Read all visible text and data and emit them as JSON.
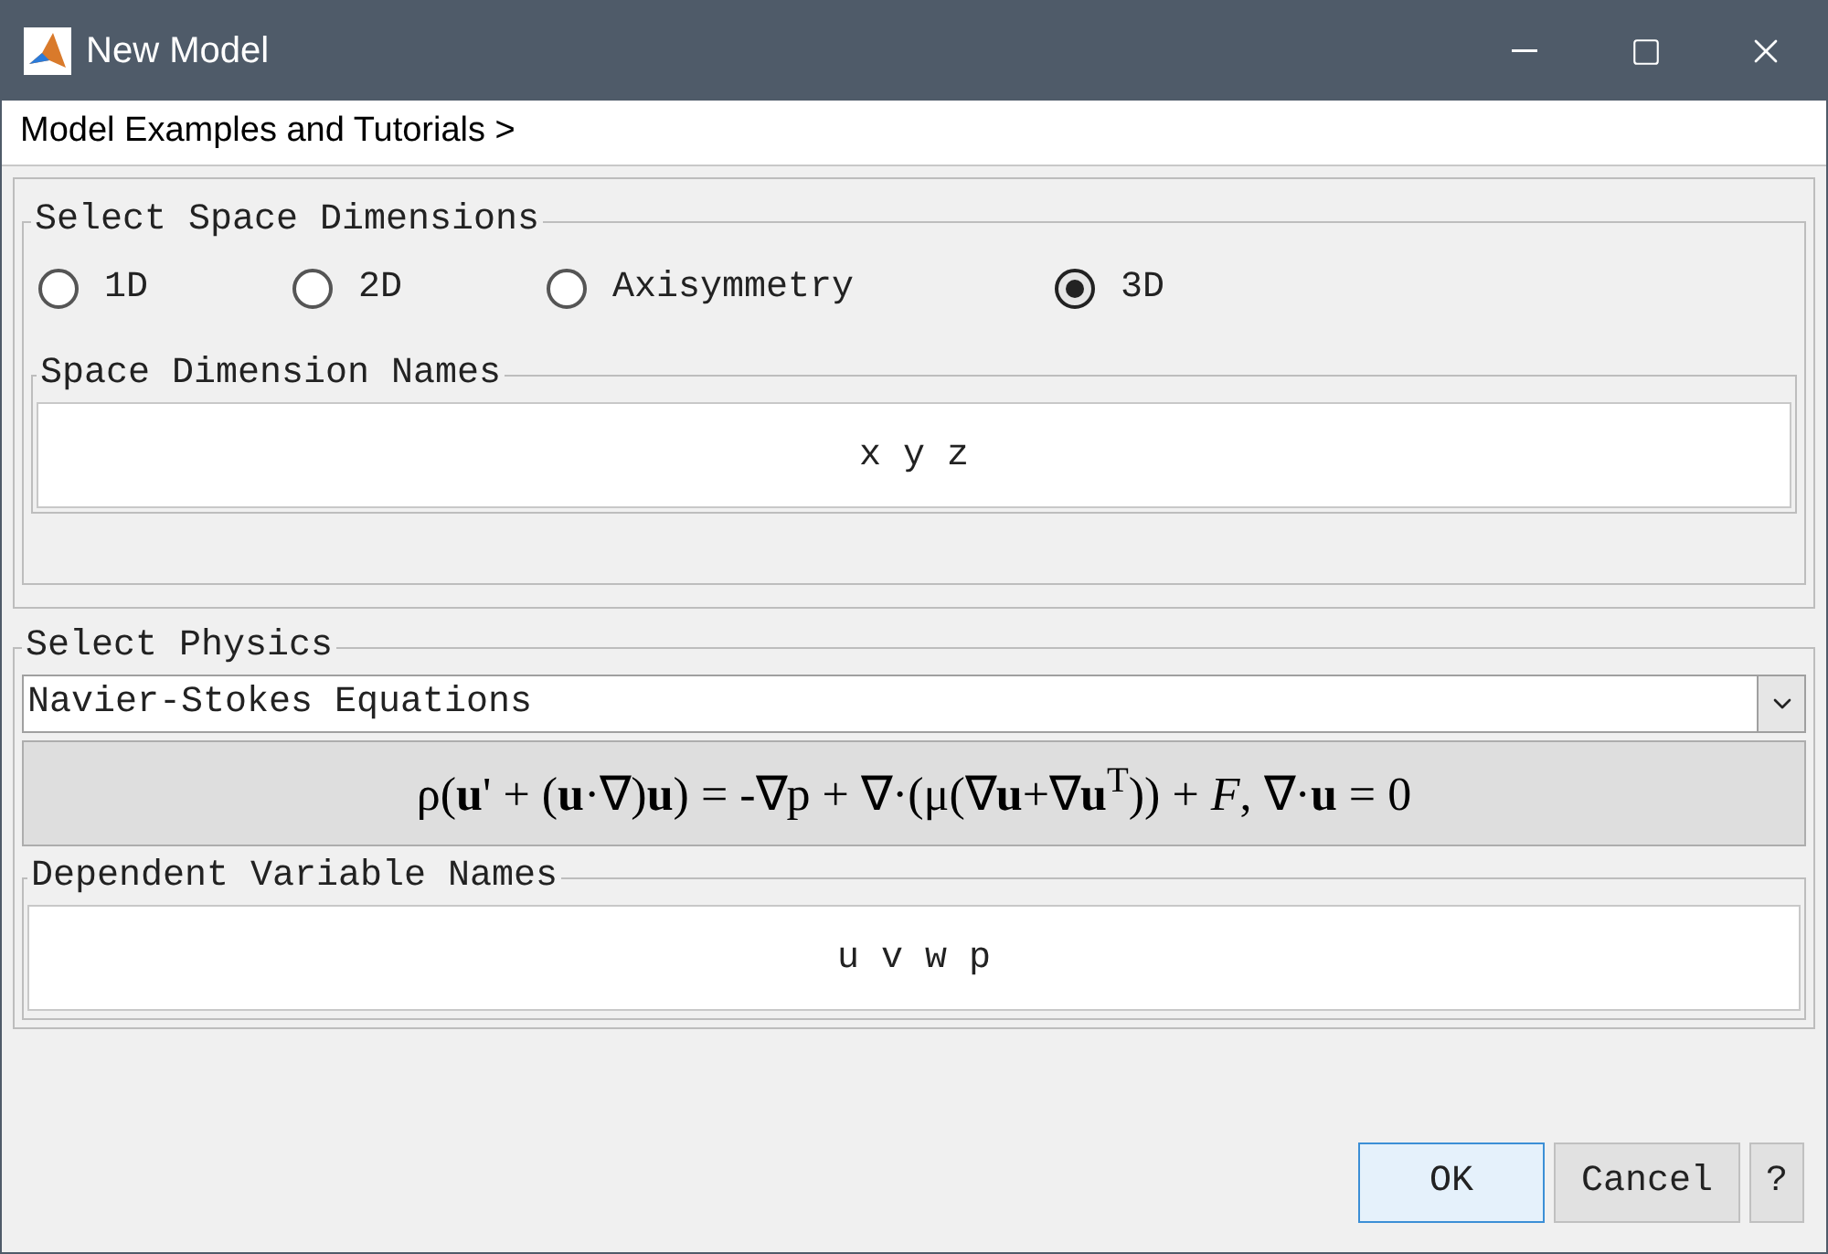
{
  "window": {
    "title": "New Model"
  },
  "breadcrumb": "Model Examples and Tutorials >",
  "space": {
    "legend": "Select Space Dimensions",
    "options": [
      {
        "label": "1D",
        "selected": false
      },
      {
        "label": "2D",
        "selected": false
      },
      {
        "label": "Axisymmetry",
        "selected": false
      },
      {
        "label": "3D",
        "selected": true
      }
    ],
    "names_legend": "Space Dimension Names",
    "names_value": "x y z"
  },
  "physics": {
    "legend": "Select Physics",
    "selection": "Navier-Stokes Equations",
    "equation": "ρ(**u**' + (**u**·∇)**u**) = -∇p + ∇·(μ(∇**u**+∇**u**$^{T}$)) + *F*, ∇·**u** = 0",
    "vars_legend": "Dependent Variable Names",
    "vars_value": "u v w p"
  },
  "buttons": [
    {
      "label": "OK",
      "kind": "default"
    },
    {
      "label": "Cancel",
      "kind": "normal"
    },
    {
      "label": "?",
      "kind": "normal"
    }
  ]
}
